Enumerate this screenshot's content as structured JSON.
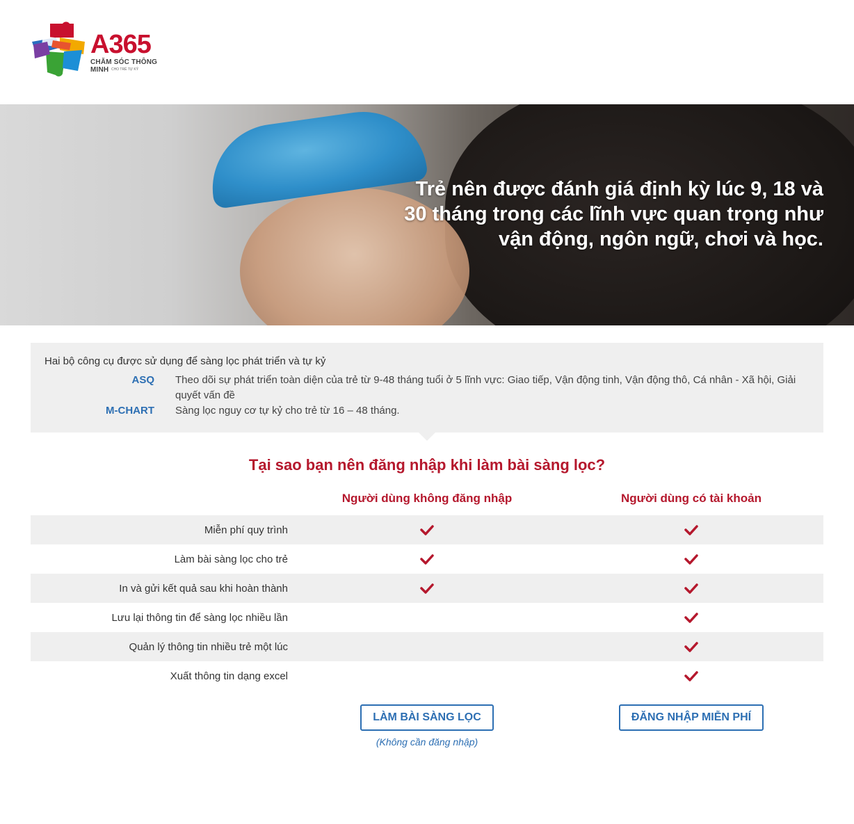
{
  "logo": {
    "text": "A365",
    "subtitle": "CHĂM SÓC THÔNG MINH",
    "subtitle_small": "CHO TRẺ TỰ KỶ"
  },
  "hero": {
    "title": "Trẻ nên được đánh giá định kỳ lúc 9, 18 và 30 tháng trong các lĩnh vực quan trọng như vận động, ngôn ngữ, chơi và học."
  },
  "tools": {
    "title": "Hai bộ công cụ được sử dụng để sàng lọc phát triển và tự kỷ",
    "items": [
      {
        "name": "ASQ",
        "desc": "Theo dõi sự phát triển toàn diện của trẻ từ 9-48 tháng tuổi ở 5 lĩnh vực: Giao tiếp, Vận động tinh, Vận động thô, Cá nhân - Xã hội, Giải quyết vấn đề"
      },
      {
        "name": "M-CHART",
        "desc": "Sàng lọc nguy cơ tự kỷ cho trẻ từ 16 – 48 tháng."
      }
    ]
  },
  "comparison": {
    "title": "Tại sao bạn nên đăng nhập khi làm bài sàng lọc?",
    "col_guest": "Người dùng không đăng nhập",
    "col_member": "Người dùng có tài khoản",
    "rows": [
      {
        "label": "Miễn phí quy trình",
        "guest": true,
        "member": true
      },
      {
        "label": "Làm bài sàng lọc cho trẻ",
        "guest": true,
        "member": true
      },
      {
        "label": "In và gửi kết quả sau khi hoàn thành",
        "guest": true,
        "member": true
      },
      {
        "label": "Lưu lại thông tin để sàng lọc nhiều lần",
        "guest": false,
        "member": true
      },
      {
        "label": "Quản lý thông tin nhiều trẻ một lúc",
        "guest": false,
        "member": true
      },
      {
        "label": "Xuất thông tin dạng excel",
        "guest": false,
        "member": true
      }
    ]
  },
  "actions": {
    "screen_button": "LÀM BÀI SÀNG LỌC",
    "screen_note": "(Không cần đăng nhập)",
    "login_button": "ĐĂNG NHẬP MIỄN PHÍ"
  },
  "colors": {
    "brand_red": "#b5182d",
    "link_blue": "#2d6fb3",
    "shade": "#efefef"
  }
}
